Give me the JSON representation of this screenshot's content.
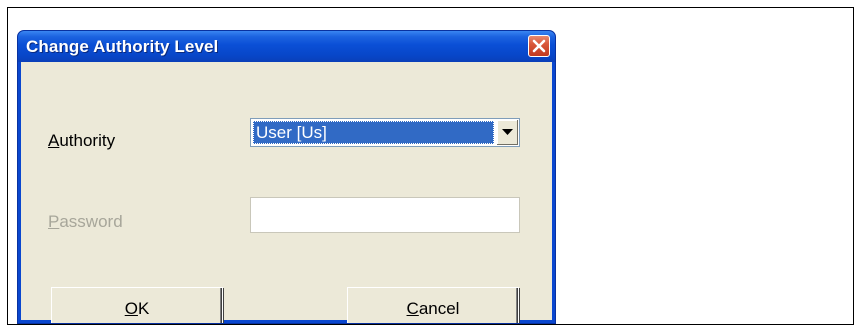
{
  "dialog": {
    "title": "Change Authority Level",
    "authority": {
      "label_mnemonic": "A",
      "label_rest": "uthority",
      "selected_value": "User [Us]"
    },
    "password": {
      "label_mnemonic": "P",
      "label_rest": "assword",
      "value": ""
    },
    "buttons": {
      "ok_mnemonic": "O",
      "ok_rest": "K",
      "cancel_mnemonic": "C",
      "cancel_rest": "ancel"
    }
  },
  "colors": {
    "titlebar": "#0a4fd6",
    "client": "#ece9d8",
    "selection": "#316ac5",
    "close_button": "#d9573a"
  }
}
